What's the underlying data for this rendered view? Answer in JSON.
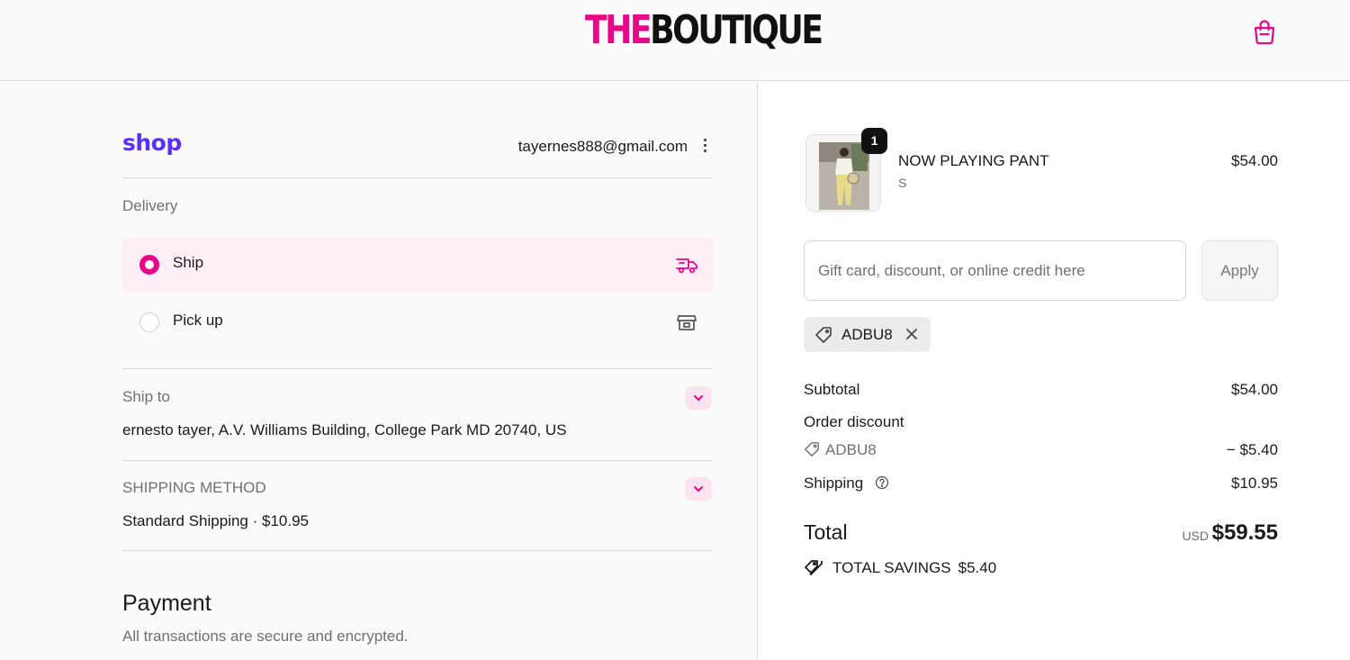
{
  "header": {
    "logo_part1": "THE",
    "logo_part2": "BOUTIQUE",
    "cart_icon": "shopping-bag-icon",
    "brand_color": "#e8068a"
  },
  "account": {
    "shop_logo": "shop",
    "email": "tayernes888@gmail.com",
    "menu_icon": "kebab-menu-icon"
  },
  "delivery": {
    "title": "Delivery",
    "options": [
      {
        "label": "Ship",
        "selected": true,
        "icon": "truck-icon"
      },
      {
        "label": "Pick up",
        "selected": false,
        "icon": "store-icon"
      }
    ]
  },
  "ship_to": {
    "label": "Ship to",
    "value": "ernesto tayer, A.V. Williams Building, College Park MD 20740, US"
  },
  "shipping_method": {
    "label": "SHIPPING METHOD",
    "value": "Standard Shipping · $10.95"
  },
  "payment": {
    "title": "Payment",
    "subtitle": "All transactions are secure and encrypted."
  },
  "cart": {
    "item": {
      "name": "NOW PLAYING PANT",
      "variant": "S",
      "price": "$54.00",
      "quantity": "1"
    },
    "discount_placeholder": "Gift card, discount, or online credit here",
    "apply_label": "Apply",
    "applied_code": "ADBU8"
  },
  "summary": {
    "subtotal_label": "Subtotal",
    "subtotal_value": "$54.00",
    "order_discount_label": "Order discount",
    "discount_code": "ADBU8",
    "discount_value": "− $5.40",
    "shipping_label": "Shipping",
    "shipping_value": "$10.95",
    "total_label": "Total",
    "currency": "USD",
    "total_value": "$59.55",
    "savings_label": "TOTAL SAVINGS",
    "savings_value": "$5.40"
  }
}
